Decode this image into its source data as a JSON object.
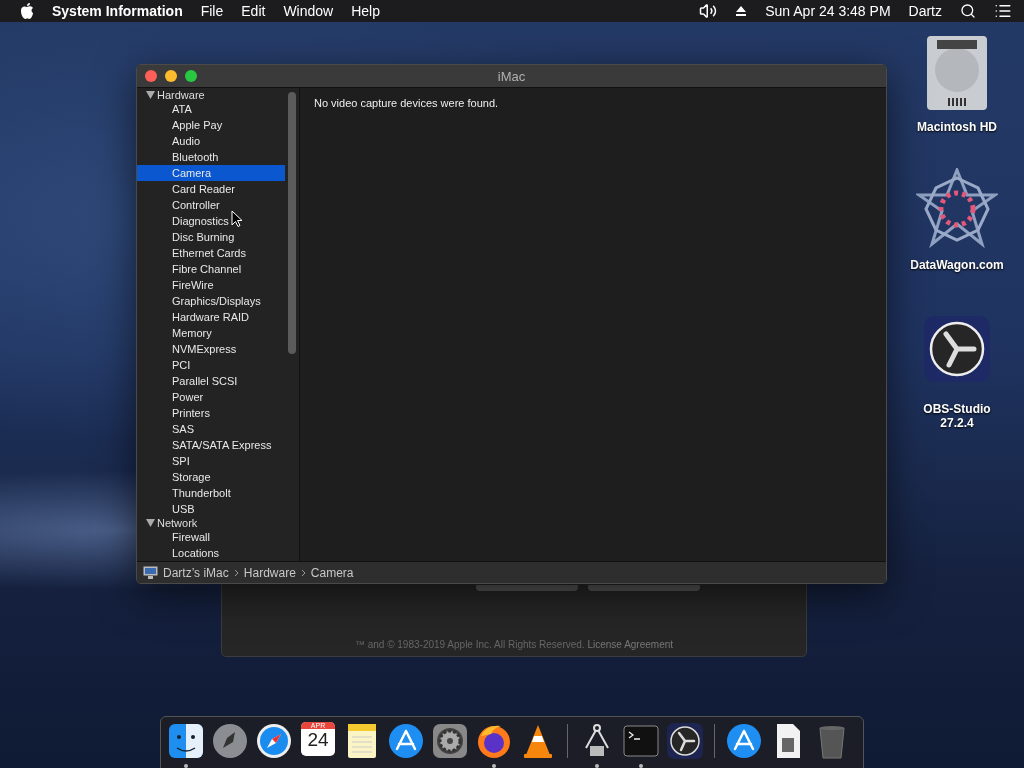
{
  "menu_bar": {
    "app_name": "System Information",
    "menus": [
      "File",
      "Edit",
      "Window",
      "Help"
    ],
    "clock": "Sun Apr 24  3:48 PM",
    "user": "Dartz"
  },
  "back_window": {
    "footer": "™ and © 1983-2019 Apple Inc. All Rights Reserved.",
    "footer_link": "License Agreement"
  },
  "window": {
    "title": "iMac",
    "sidebar": [
      {
        "label": "Hardware",
        "expanded": true,
        "children": [
          {
            "label": "ATA",
            "selected": false
          },
          {
            "label": "Apple Pay",
            "selected": false
          },
          {
            "label": "Audio",
            "selected": false
          },
          {
            "label": "Bluetooth",
            "selected": false
          },
          {
            "label": "Camera",
            "selected": true
          },
          {
            "label": "Card Reader",
            "selected": false
          },
          {
            "label": "Controller",
            "selected": false
          },
          {
            "label": "Diagnostics",
            "selected": false
          },
          {
            "label": "Disc Burning",
            "selected": false
          },
          {
            "label": "Ethernet Cards",
            "selected": false
          },
          {
            "label": "Fibre Channel",
            "selected": false
          },
          {
            "label": "FireWire",
            "selected": false
          },
          {
            "label": "Graphics/Displays",
            "selected": false
          },
          {
            "label": "Hardware RAID",
            "selected": false
          },
          {
            "label": "Memory",
            "selected": false
          },
          {
            "label": "NVMExpress",
            "selected": false
          },
          {
            "label": "PCI",
            "selected": false
          },
          {
            "label": "Parallel SCSI",
            "selected": false
          },
          {
            "label": "Power",
            "selected": false
          },
          {
            "label": "Printers",
            "selected": false
          },
          {
            "label": "SAS",
            "selected": false
          },
          {
            "label": "SATA/SATA Express",
            "selected": false
          },
          {
            "label": "SPI",
            "selected": false
          },
          {
            "label": "Storage",
            "selected": false
          },
          {
            "label": "Thunderbolt",
            "selected": false
          },
          {
            "label": "USB",
            "selected": false
          }
        ]
      },
      {
        "label": "Network",
        "expanded": true,
        "children": [
          {
            "label": "Firewall",
            "selected": false
          },
          {
            "label": "Locations",
            "selected": false
          }
        ]
      }
    ],
    "message": "No video capture devices were found.",
    "path": [
      "Dartz’s iMac",
      "Hardware",
      "Camera"
    ]
  },
  "desktop_icons": [
    {
      "kind": "disk",
      "label": "Macintosh HD"
    },
    {
      "kind": "star",
      "label": "DataWagon.com"
    },
    {
      "kind": "obs",
      "label": "OBS-Studio\n27.2.4"
    }
  ],
  "dock": [
    {
      "kind": "finder",
      "running": true
    },
    {
      "kind": "launchpad",
      "running": false
    },
    {
      "kind": "safari",
      "running": false
    },
    {
      "kind": "calendar",
      "running": false,
      "month": "APR",
      "day": "24"
    },
    {
      "kind": "notes",
      "running": false
    },
    {
      "kind": "appstore",
      "running": false
    },
    {
      "kind": "settings",
      "running": false
    },
    {
      "kind": "firefox",
      "running": true
    },
    {
      "kind": "vlc",
      "running": false
    },
    {
      "kind": "separator"
    },
    {
      "kind": "utility",
      "running": true
    },
    {
      "kind": "terminal",
      "running": true
    },
    {
      "kind": "obs",
      "running": false
    },
    {
      "kind": "separator"
    },
    {
      "kind": "appstore",
      "running": false
    },
    {
      "kind": "document",
      "running": false
    },
    {
      "kind": "trash",
      "running": false
    }
  ]
}
